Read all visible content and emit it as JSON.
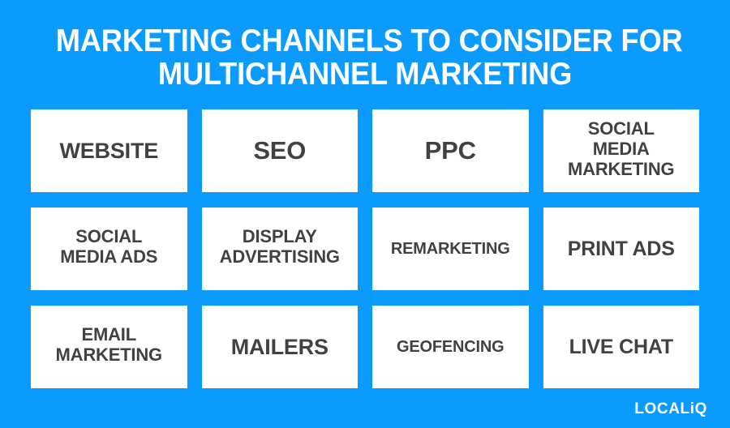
{
  "theme": {
    "background_color": "#0b9bff",
    "card_color": "#ffffff",
    "card_text_color": "#414141",
    "title_color": "#ffffff"
  },
  "title": {
    "line1": "MARKETING CHANNELS TO CONSIDER FOR",
    "line2": "MULTICHANNEL MARKETING",
    "full": "MARKETING CHANNELS TO CONSIDER FOR MULTICHANNEL MARKETING"
  },
  "grid": {
    "columns": 4,
    "rows": 3,
    "cards": [
      {
        "label": "WEBSITE",
        "size": "lg",
        "lines": 1
      },
      {
        "label": "SEO",
        "size": "xl",
        "lines": 1
      },
      {
        "label": "PPC",
        "size": "xl",
        "lines": 1
      },
      {
        "label": "SOCIAL\nMEDIA\nMARKETING",
        "size": "sm",
        "lines": 3
      },
      {
        "label": "SOCIAL\nMEDIA ADS",
        "size": "sm",
        "lines": 2
      },
      {
        "label": "DISPLAY\nADVERTISING",
        "size": "sm",
        "lines": 2
      },
      {
        "label": "REMARKETING",
        "size": "xs",
        "lines": 1
      },
      {
        "label": "PRINT ADS",
        "size": "md",
        "lines": 1
      },
      {
        "label": "EMAIL\nMARKETING",
        "size": "sm",
        "lines": 2
      },
      {
        "label": "MAILERS",
        "size": "lg",
        "lines": 1
      },
      {
        "label": "GEOFENCING",
        "size": "xs",
        "lines": 1
      },
      {
        "label": "LIVE CHAT",
        "size": "md",
        "lines": 1
      }
    ]
  },
  "logo": {
    "text": "LOCALiQ"
  }
}
